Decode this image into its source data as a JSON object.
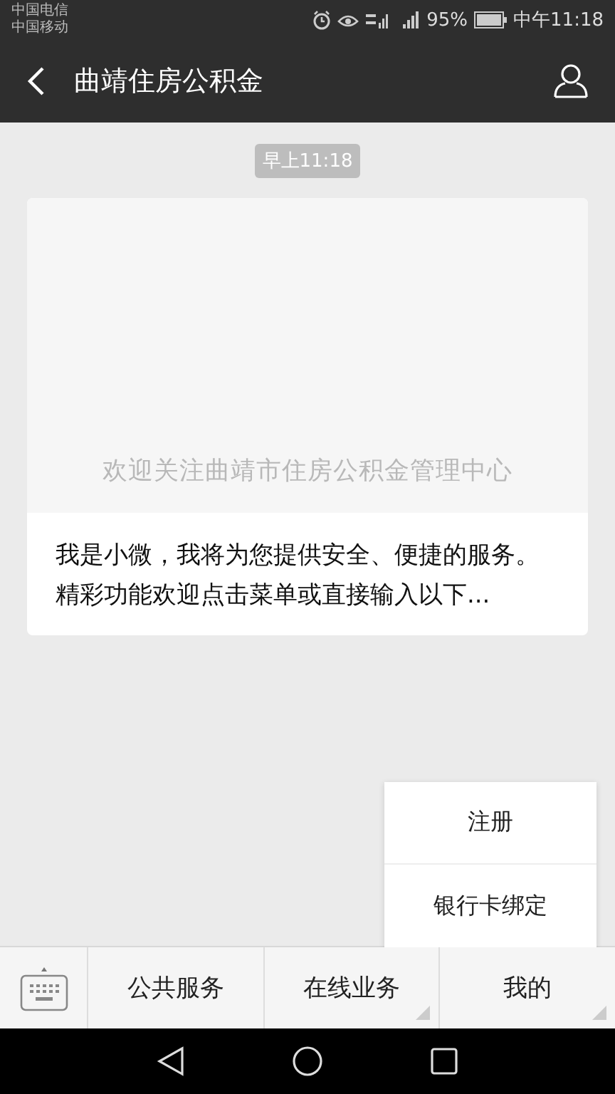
{
  "status_bar": {
    "carriers": [
      "中国电信",
      "中国移动"
    ],
    "battery": "95%",
    "time": "中午11:18"
  },
  "header": {
    "title": "曲靖住房公积金"
  },
  "chat": {
    "timestamp": "早上11:18",
    "card": {
      "caption": "欢迎关注曲靖市住房公积金管理中心",
      "summary": "我是小微，我将为您提供安全、便捷的服务。精彩功能欢迎点击菜单或直接输入以下..."
    }
  },
  "popup_menu": {
    "items": [
      "注册",
      "银行卡绑定"
    ]
  },
  "menu_bar": {
    "items": [
      {
        "label": "公共服务",
        "has_submenu": false
      },
      {
        "label": "在线业务",
        "has_submenu": true
      },
      {
        "label": "我的",
        "has_submenu": true
      }
    ]
  }
}
